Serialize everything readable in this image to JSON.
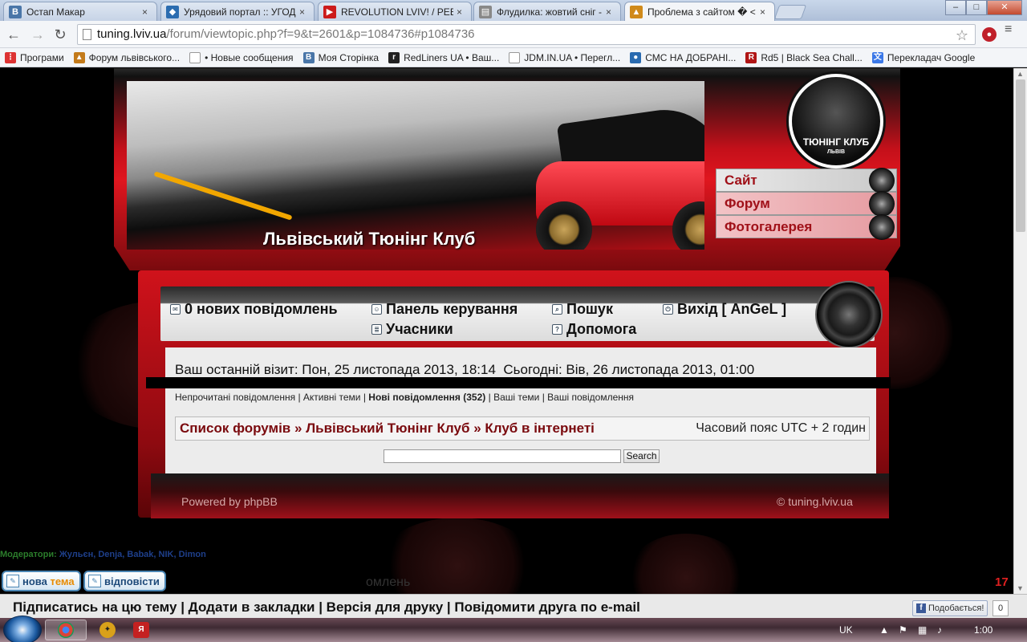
{
  "browser": {
    "tabs": [
      {
        "title": "Остап Макар",
        "icon": "vk-icon",
        "color": "#4a76a8",
        "glyph": "В"
      },
      {
        "title": "Урядовий портал :: УГОД",
        "icon": "gov-portal-icon",
        "color": "#2b6cb0",
        "glyph": "◆"
      },
      {
        "title": "REVOLUTION LVIV! / РЕВО",
        "icon": "youtube-icon",
        "color": "#cc1a1a",
        "glyph": "▶"
      },
      {
        "title": "Флудилка: жовтий сніг -",
        "icon": "forum-icon",
        "color": "#888888",
        "glyph": "▤"
      },
      {
        "title": "Проблема з сайтом � <",
        "icon": "car-icon",
        "color": "#d08a1a",
        "glyph": "▲"
      }
    ],
    "url_host": "tuning.lviv.ua",
    "url_path": "/forum/viewtopic.php?f=9&t=2601&p=1084736#p1084736",
    "bookmarks": [
      {
        "label": "Програми",
        "icon": "apps-icon",
        "color": "#d33",
        "glyph": "⋮"
      },
      {
        "label": "Форум львівського...",
        "icon": "car-icon",
        "color": "#c37a1a",
        "glyph": "▲"
      },
      {
        "label": "• Новые сообщения",
        "icon": "page-icon",
        "color": "#999",
        "glyph": ""
      },
      {
        "label": "Моя Сторінка",
        "icon": "vk-icon",
        "color": "#4a76a8",
        "glyph": "В"
      },
      {
        "label": "RedLiners UA • Ваш...",
        "icon": "redliners-icon",
        "color": "#222",
        "glyph": "r"
      },
      {
        "label": "JDM.IN.UA • Перегл...",
        "icon": "page-icon",
        "color": "#999",
        "glyph": ""
      },
      {
        "label": "СМС НА ДОБРАНІ...",
        "icon": "sms-icon",
        "color": "#2a6bb0",
        "glyph": "●"
      },
      {
        "label": "Rd5 | Black Sea Chall...",
        "icon": "rd5-icon",
        "color": "#b01515",
        "glyph": "R"
      },
      {
        "label": "Перекладач Google",
        "icon": "translate-icon",
        "color": "#3b78e7",
        "glyph": "文"
      }
    ]
  },
  "header": {
    "title": "Львівський Тюнінг Клуб",
    "logo_title": "ТЮНІНГ КЛУБ",
    "logo_sub": "ЛЬВІВ",
    "side_nav": [
      "Сайт",
      "Форум",
      "Фотогалерея"
    ]
  },
  "navbar": {
    "new_posts": "0 нових повідомлень",
    "control_panel": "Панель керування",
    "search": "Пошук",
    "logout": "Вихід [ AnGeL ]",
    "members": "Учасники",
    "help": "Допомога"
  },
  "info": {
    "last_visit": "Ваш останній візит: Пон, 25 листопада 2013, 18:14",
    "today": "Сьогодні: Вів, 26 листопада 2013, 01:00"
  },
  "quicklinks": {
    "unread": "Непрочитані повідомлення",
    "active": "Активні теми",
    "new_posts": "Нові повідомлення (352)",
    "your_topics": "Ваші теми",
    "your_posts": "Ваші повідомлення"
  },
  "breadcrumb": {
    "forums": "Список форумів",
    "club": "Львівський Тюнінг Клуб",
    "section": "Клуб в інтернеті",
    "sep": "»",
    "timezone": "Часовий пояс UTC + 2 годин"
  },
  "search": {
    "button": "Search"
  },
  "footer": {
    "powered": "Powered by phpBB",
    "copyright": "©  tuning.lviv.ua"
  },
  "moderators": {
    "label": "Модератори:",
    "names": "Жульєн, Denja, Babak, NIK, Dimon"
  },
  "actions": {
    "new_topic_a": "нова",
    "new_topic_b": "тема",
    "reply": "відповісти",
    "count": "17",
    "ghost": "омлень"
  },
  "bottombar": {
    "links": "Підписатись на цю тему | Додати в закладки | Версія для друку | Повідомити друга по e-mail",
    "like": "Подобається!",
    "like_count": "0"
  },
  "taskbar": {
    "lang": "UK",
    "time": "1:00"
  }
}
